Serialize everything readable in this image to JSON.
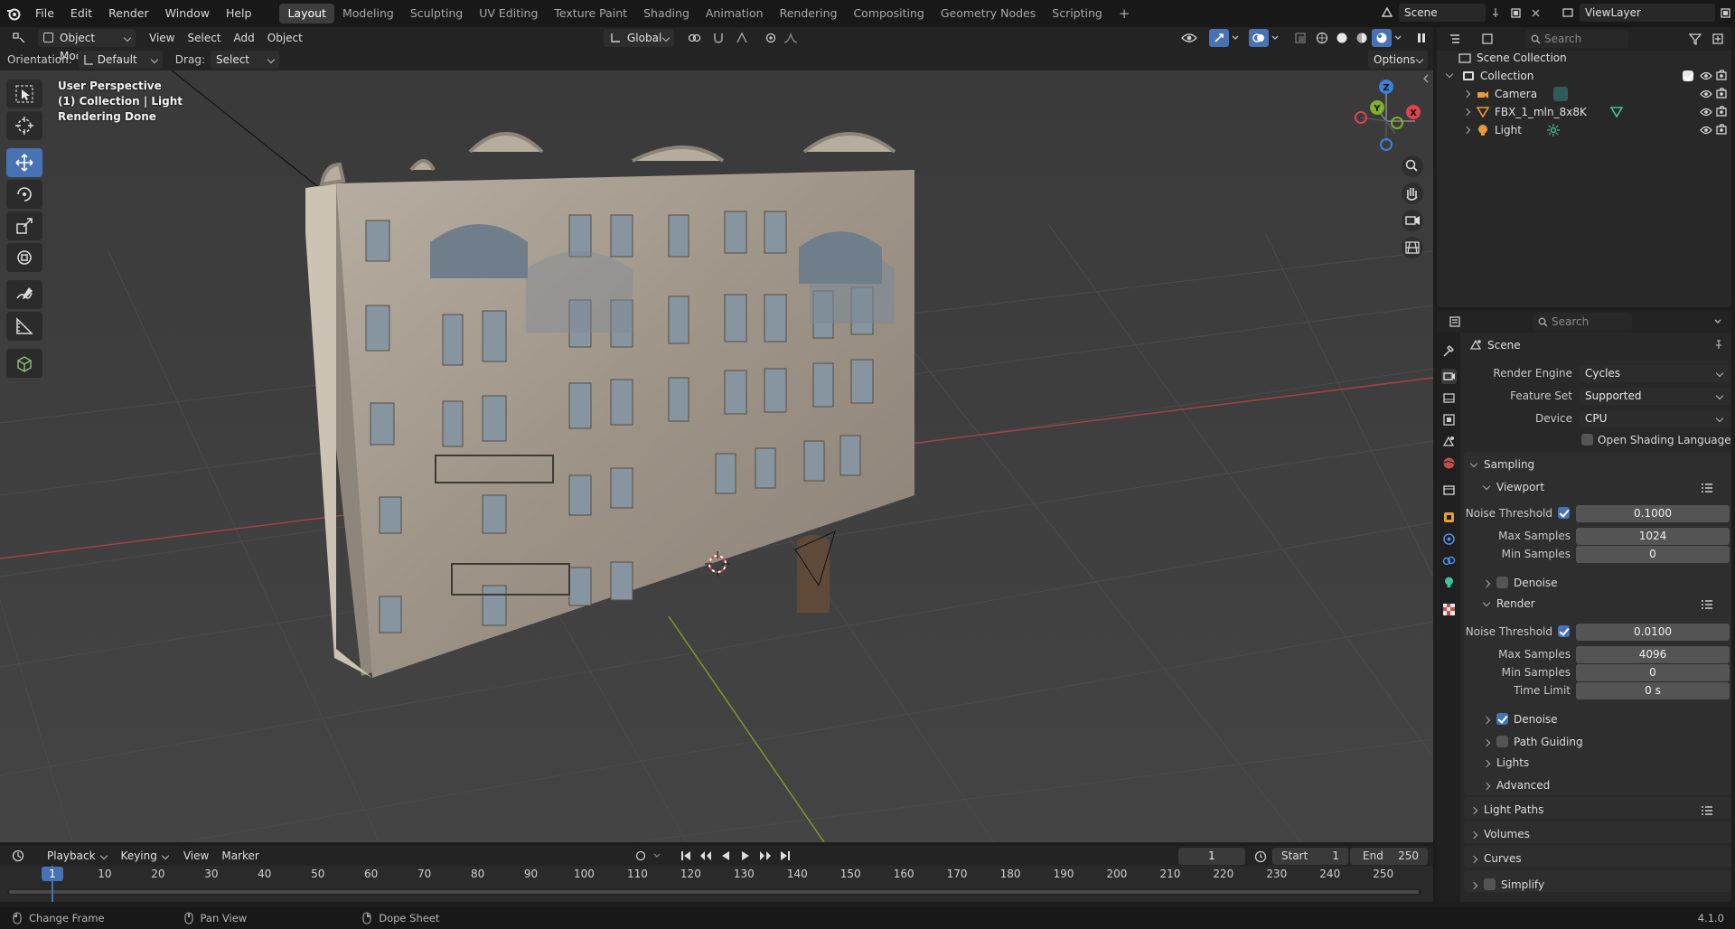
{
  "topbar": {
    "menus": [
      "File",
      "Edit",
      "Render",
      "Window",
      "Help"
    ],
    "workspaces": [
      "Layout",
      "Modeling",
      "Sculpting",
      "UV Editing",
      "Texture Paint",
      "Shading",
      "Animation",
      "Rendering",
      "Compositing",
      "Geometry Nodes",
      "Scripting"
    ],
    "active_workspace": "Layout",
    "scene_name": "Scene",
    "viewlayer_name": "ViewLayer"
  },
  "viewport_header": {
    "mode": "Object Mode",
    "menus": [
      "View",
      "Select",
      "Add",
      "Object"
    ],
    "transform_orientation": "Global",
    "options_label": "Options",
    "orientation_label": "Orientation:",
    "orientation_value": "Default",
    "drag_label": "Drag:",
    "drag_value": "Select Box"
  },
  "viewport_overlay": {
    "line1": "User Perspective",
    "line2": "(1) Collection | Light",
    "line3": "Rendering Done",
    "gizmo": {
      "x": "X",
      "y": "Y",
      "z": "Z"
    }
  },
  "outliner": {
    "search_placeholder": "Search",
    "root": "Scene Collection",
    "collection": "Collection",
    "items": [
      {
        "name": "Camera"
      },
      {
        "name": "FBX_1_mln_8x8K"
      },
      {
        "name": "Light"
      }
    ]
  },
  "properties": {
    "search_placeholder": "Search",
    "context_title": "Scene",
    "render_engine_label": "Render Engine",
    "render_engine": "Cycles",
    "feature_set_label": "Feature Set",
    "feature_set": "Supported",
    "device_label": "Device",
    "device": "CPU",
    "osl_label": "Open Shading Language",
    "sampling": "Sampling",
    "viewport": {
      "title": "Viewport",
      "noise_threshold_label": "Noise Threshold",
      "noise_threshold": "0.1000",
      "max_samples_label": "Max Samples",
      "max_samples": "1024",
      "min_samples_label": "Min Samples",
      "min_samples": "0",
      "denoise_label": "Denoise"
    },
    "render": {
      "title": "Render",
      "noise_threshold_label": "Noise Threshold",
      "noise_threshold": "0.0100",
      "max_samples_label": "Max Samples",
      "max_samples": "4096",
      "min_samples_label": "Min Samples",
      "min_samples": "0",
      "time_limit_label": "Time Limit",
      "time_limit": "0 s",
      "denoise_label": "Denoise",
      "path_guiding_label": "Path Guiding",
      "lights_label": "Lights",
      "advanced_label": "Advanced"
    },
    "sections": [
      "Light Paths",
      "Volumes",
      "Curves",
      "Simplify"
    ]
  },
  "timeline": {
    "menus": [
      "Playback",
      "Keying",
      "View",
      "Marker"
    ],
    "current_frame": "1",
    "start_label": "Start",
    "start": "1",
    "end_label": "End",
    "end": "250",
    "ticks": [
      "10",
      "20",
      "30",
      "40",
      "50",
      "60",
      "70",
      "80",
      "90",
      "100",
      "110",
      "120",
      "130",
      "140",
      "150",
      "160",
      "170",
      "180",
      "190",
      "200",
      "210",
      "220",
      "230",
      "240",
      "250"
    ],
    "playhead_label": "1"
  },
  "statusbar": {
    "items": [
      "Change Frame",
      "Pan View",
      "Dope Sheet"
    ],
    "version": "4.1.0"
  }
}
